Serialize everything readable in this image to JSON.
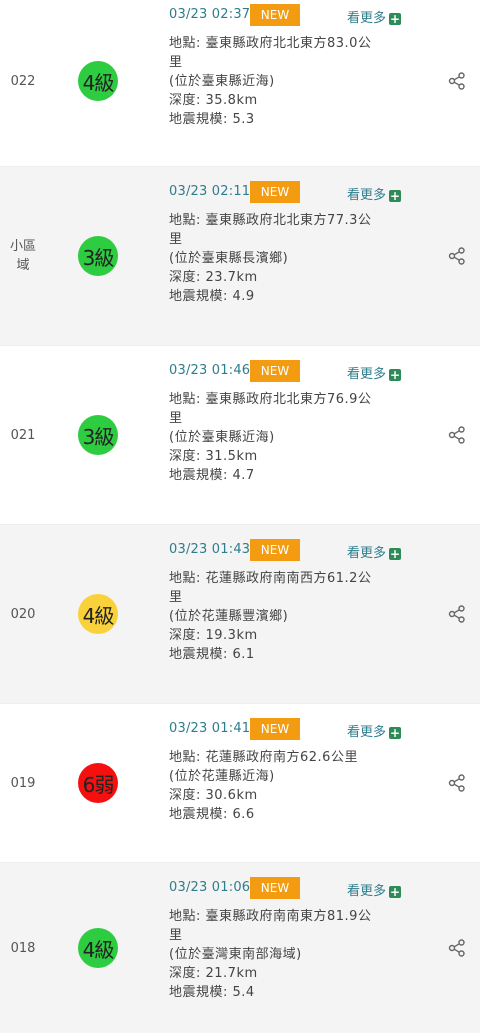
{
  "colors": {
    "time_text": "#2e7d8c",
    "new_badge": "#f39c12",
    "intensity_green": "#2ecc40",
    "intensity_yellow": "#f9d23b",
    "intensity_red": "#f50f0f",
    "plus_icon": "#2e8b57"
  },
  "more_label": "看更多",
  "new_label": "NEW",
  "rows": [
    {
      "no": "022",
      "intensity": "4級",
      "intensity_color": "green",
      "time": "03/23 02:37",
      "loc_line1": "地點: 臺東縣政府北北東方83.0公",
      "loc_line2": "里",
      "loc_sub": "(位於臺東縣近海)",
      "depth": "深度: 35.8km",
      "magnitude": "地震規模: 5.3",
      "share_icon": "share-icon"
    },
    {
      "no": "小區域",
      "intensity": "3級",
      "intensity_color": "green",
      "time": "03/23 02:11",
      "loc_line1": "地點: 臺東縣政府北北東方77.3公",
      "loc_line2": "里",
      "loc_sub": "(位於臺東縣長濱鄉)",
      "depth": "深度: 23.7km",
      "magnitude": "地震規模: 4.9",
      "share_icon": "share-icon"
    },
    {
      "no": "021",
      "intensity": "3級",
      "intensity_color": "green",
      "time": "03/23 01:46",
      "loc_line1": "地點: 臺東縣政府北北東方76.9公",
      "loc_line2": "里",
      "loc_sub": "(位於臺東縣近海)",
      "depth": "深度: 31.5km",
      "magnitude": "地震規模: 4.7",
      "share_icon": "share-icon"
    },
    {
      "no": "020",
      "intensity": "4級",
      "intensity_color": "yellow",
      "time": "03/23 01:43",
      "loc_line1": "地點: 花蓮縣政府南南西方61.2公",
      "loc_line2": "里",
      "loc_sub": "(位於花蓮縣豐濱鄉)",
      "depth": "深度: 19.3km",
      "magnitude": "地震規模: 6.1",
      "share_icon": "share-icon"
    },
    {
      "no": "019",
      "intensity": "6弱",
      "intensity_color": "red",
      "time": "03/23 01:41",
      "loc_line1": "地點: 花蓮縣政府南方62.6公里",
      "loc_line2": "",
      "loc_sub": "(位於花蓮縣近海)",
      "depth": "深度: 30.6km",
      "magnitude": "地震規模: 6.6",
      "share_icon": "share-icon"
    },
    {
      "no": "018",
      "intensity": "4級",
      "intensity_color": "green",
      "time": "03/23 01:06",
      "loc_line1": "地點: 臺東縣政府南南東方81.9公",
      "loc_line2": "里",
      "loc_sub": "(位於臺灣東南部海域)",
      "depth": "深度: 21.7km",
      "magnitude": "地震規模: 5.4",
      "share_icon": "share-icon"
    }
  ]
}
